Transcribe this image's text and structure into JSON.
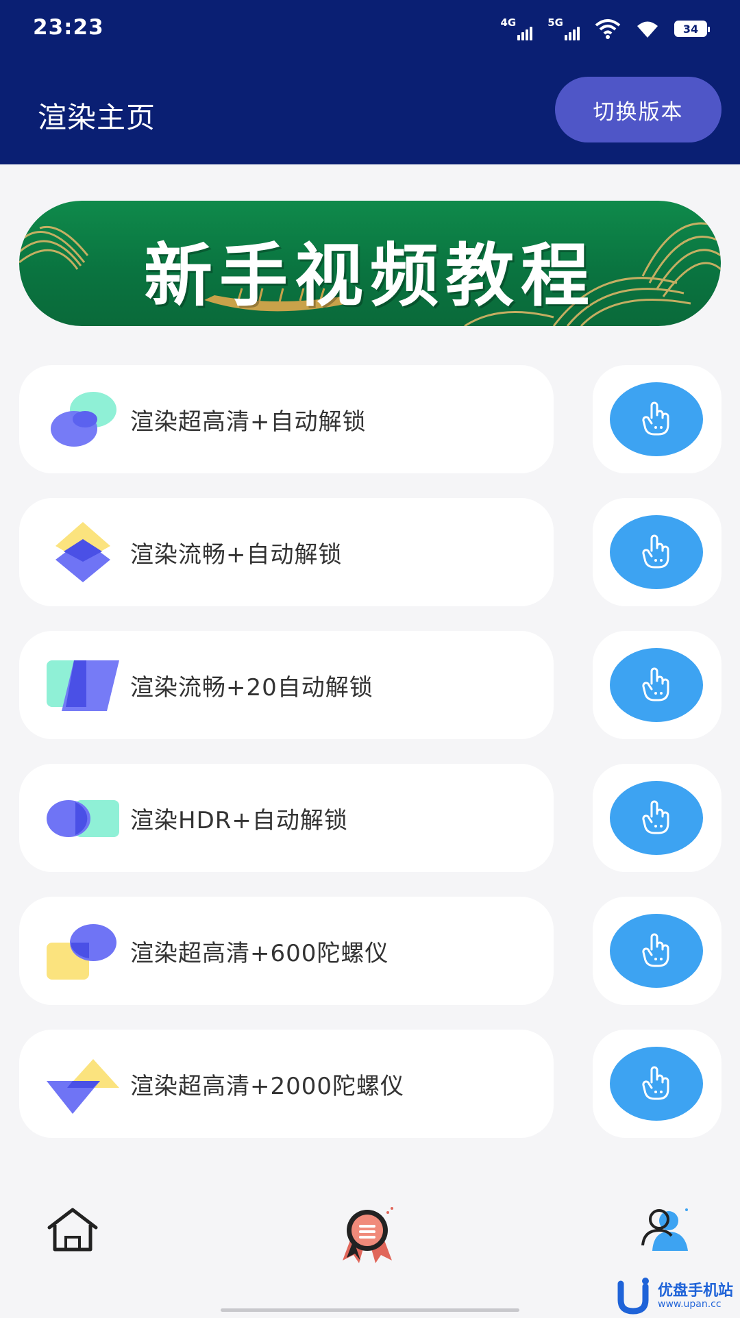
{
  "status_bar": {
    "time": "23:23",
    "network_1": "4G",
    "network_2": "5G",
    "battery": "34"
  },
  "header": {
    "title": "渲染主页",
    "switch_button": "切换版本",
    "background_color": "#0a1f73",
    "button_color": "#4f56c7"
  },
  "banner": {
    "title": "新手视频教程",
    "color": "#0f8a4b"
  },
  "features": [
    {
      "label": "渲染超高清+自动解锁",
      "icon": "overlap-circles-icon"
    },
    {
      "label": "渲染流畅+自动解锁",
      "icon": "stacked-diamonds-icon"
    },
    {
      "label": "渲染流畅+20自动解锁",
      "icon": "skewed-cards-icon"
    },
    {
      "label": "渲染HDR+自动解锁",
      "icon": "circle-square-icon"
    },
    {
      "label": "渲染超高清+600陀螺仪",
      "icon": "square-circle-icon"
    },
    {
      "label": "渲染超高清+2000陀螺仪",
      "icon": "triangles-icon"
    }
  ],
  "action_button": {
    "icon": "tap-hand-icon",
    "color": "#3da3f2"
  },
  "bottom_nav": {
    "items": [
      {
        "icon": "home-icon"
      },
      {
        "icon": "award-badge-icon"
      },
      {
        "icon": "users-icon"
      }
    ]
  },
  "watermark": {
    "text": "优盘手机站",
    "url": "www.upan.cc"
  }
}
